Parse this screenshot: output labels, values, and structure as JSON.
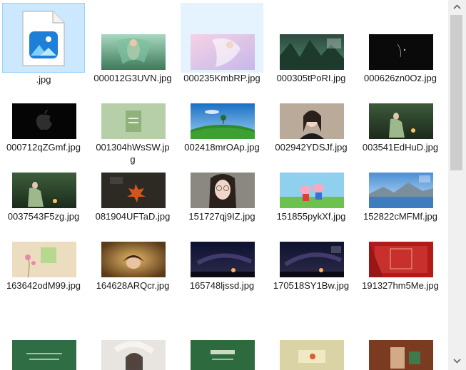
{
  "files": [
    {
      "name": ".jpg",
      "kind": "generic-image-file"
    },
    {
      "name": "000012G3UVN.jpg",
      "thumb": "fairy-green"
    },
    {
      "name": "000235KmbRP.jpg",
      "thumb": "fairy-pink"
    },
    {
      "name": "000305tPoRI.jpg",
      "thumb": "forest-calendar"
    },
    {
      "name": "000626zn0Oz.jpg",
      "thumb": "dark-face"
    },
    {
      "name": "000712qZGmf.jpg",
      "thumb": "apple-logo"
    },
    {
      "name": "001304hWsSW.jpg",
      "thumb": "green-card"
    },
    {
      "name": "002418mrOAp.jpg",
      "thumb": "green-field"
    },
    {
      "name": "002942YDSJf.jpg",
      "thumb": "girl-portrait"
    },
    {
      "name": "003541EdHuD.jpg",
      "thumb": "girl-lantern"
    },
    {
      "name": "0037543F5zg.jpg",
      "thumb": "girl-lantern-2"
    },
    {
      "name": "081904UFTaD.jpg",
      "thumb": "maple-leaf"
    },
    {
      "name": "151727qj9IZ.jpg",
      "thumb": "glasses-girl"
    },
    {
      "name": "151855pykXf.jpg",
      "thumb": "peppa-pig"
    },
    {
      "name": "152822cMFMf.jpg",
      "thumb": "lake-mountain"
    },
    {
      "name": "163642odM99.jpg",
      "thumb": "flower-notes"
    },
    {
      "name": "164628ARQcr.jpg",
      "thumb": "autumn-girl"
    },
    {
      "name": "165748ljssd.jpg",
      "thumb": "night-sky"
    },
    {
      "name": "170518SY1Bw.jpg",
      "thumb": "night-sky-2"
    },
    {
      "name": "191327hm5Me.jpg",
      "thumb": "red-calendar"
    },
    {
      "name": "",
      "thumb": "green-poem"
    },
    {
      "name": "",
      "thumb": "white-girl"
    },
    {
      "name": "",
      "thumb": "green-poem-2"
    },
    {
      "name": "",
      "thumb": "yellow-calendar"
    },
    {
      "name": "",
      "thumb": "brown-calendar"
    }
  ],
  "selected_index": 0,
  "hover_index": 2,
  "scrollbar": {
    "up_icon": "chevron-up-icon",
    "down_icon": "chevron-down-icon"
  },
  "colors": {
    "selection": "#cce8ff",
    "hover": "#e5f3ff",
    "scroll_thumb": "#cdcdcd"
  }
}
